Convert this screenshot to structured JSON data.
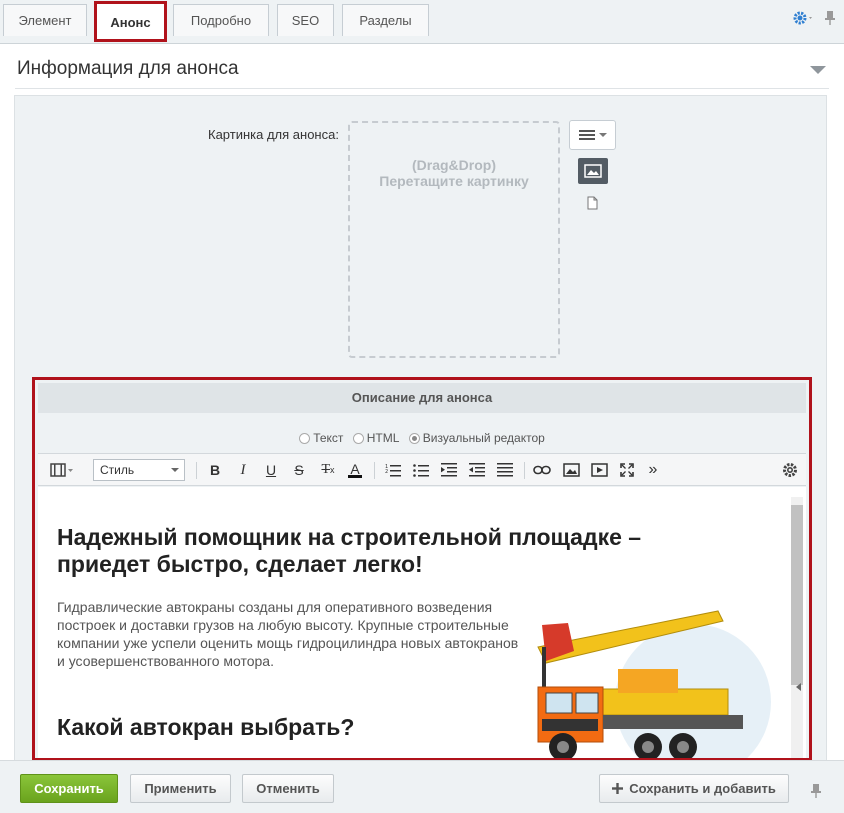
{
  "tabs": [
    {
      "label": "Элемент"
    },
    {
      "label": "Анонс"
    },
    {
      "label": "Подробно"
    },
    {
      "label": "SEO"
    },
    {
      "label": "Разделы"
    }
  ],
  "section": {
    "title": "Информация для анонса"
  },
  "picture": {
    "label": "Картинка для анонса:",
    "drop_line1": "(Drag&Drop)",
    "drop_line2": "Перетащите картинку"
  },
  "description": {
    "title": "Описание для анонса",
    "modes": [
      {
        "label": "Текст",
        "selected": false
      },
      {
        "label": "HTML",
        "selected": false
      },
      {
        "label": "Визуальный редактор",
        "selected": true
      }
    ],
    "style_select": "Стиль",
    "toolbar": {
      "bold": "B",
      "italic": "I",
      "underline": "U",
      "strike": "S",
      "clear": "T",
      "clear_sub": "x",
      "color": "A",
      "more": "»"
    },
    "content": {
      "heading": "Надежный помощник на строительной площадке – приедет быстро, сделает легко!",
      "paragraph": "Гидравлические автокраны созданы для оперативного возведения построек и доставки грузов на любую высоту. Крупные строительные компании уже успели оценить мощь гидроцилиндра новых автокранов и усовершенствованного мотора.",
      "subheading": "Какой автокран выбрать?"
    }
  },
  "footer": {
    "save": "Сохранить",
    "apply": "Применить",
    "cancel": "Отменить",
    "save_add": "Сохранить и добавить"
  },
  "colors": {
    "highlight": "#b0121b",
    "primary": "#7bb52b"
  }
}
